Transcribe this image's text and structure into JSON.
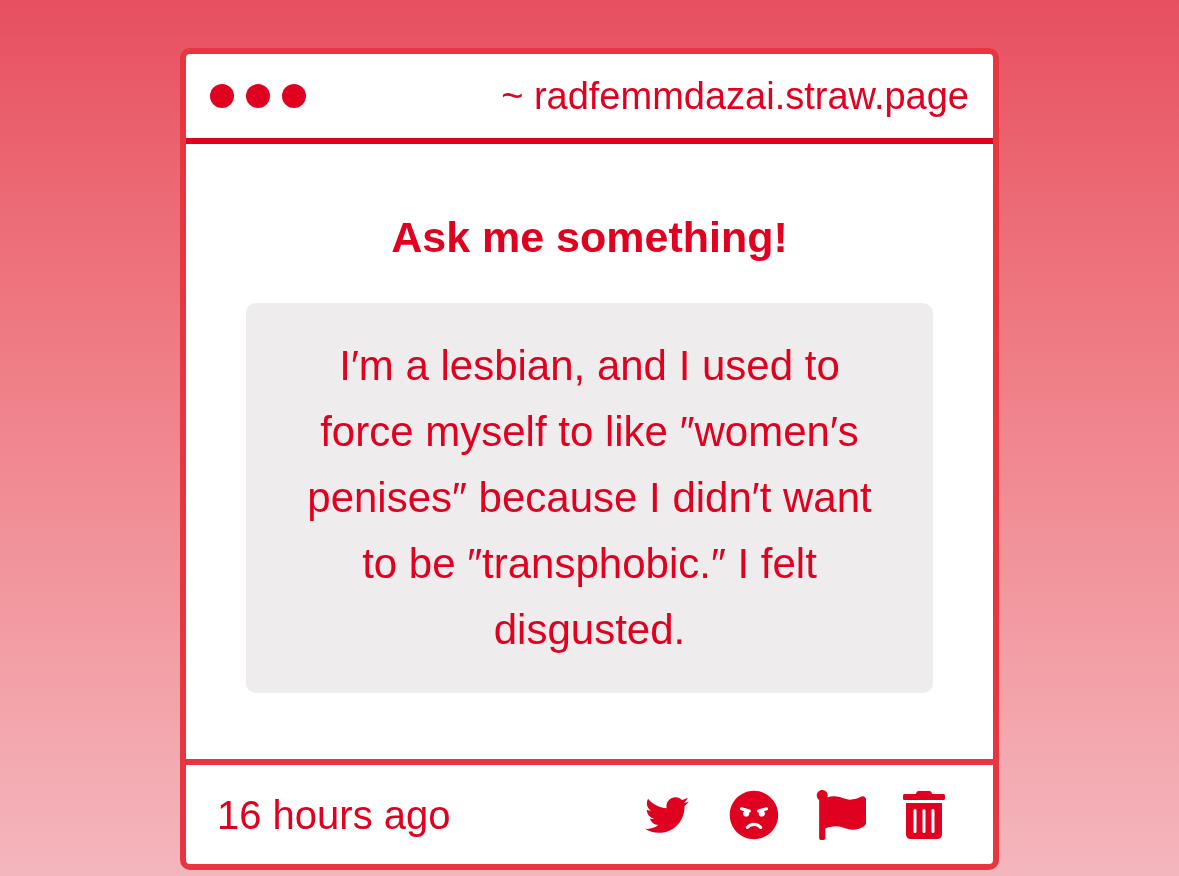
{
  "window": {
    "url": "~ radfemmdazai.straw.page"
  },
  "prompt": {
    "title": "Ask me something!"
  },
  "question": {
    "text": "I′m a lesbian, and I used to force myself to like ″women′s penises″ because I didn′t want to be ″transphobic.″ I felt disgusted."
  },
  "footer": {
    "time": "16 hours ago"
  }
}
